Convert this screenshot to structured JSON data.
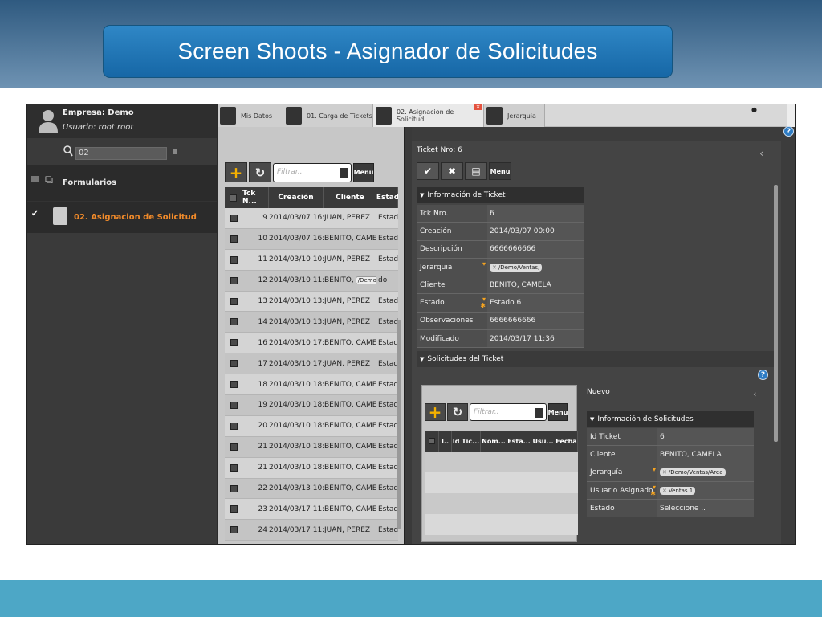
{
  "slide": {
    "title": "Screen Shoots - Asignador de Solicitudes",
    "colors": {
      "top": "#2f5a80",
      "title_bar": "#1f78b8",
      "bottom": "#4da7c6"
    }
  },
  "sidebar": {
    "company": "Empresa: Demo",
    "user": "Usuario: root root",
    "search_value": "02",
    "section_label": "Formularios",
    "active_item": "02. Asignacion de Solicitud",
    "active_color": "#f08a2a"
  },
  "tabs": [
    {
      "label": "Mis Datos"
    },
    {
      "label": "01. Carga de Tickets"
    },
    {
      "label": "02. Asignacion de Solicitud"
    },
    {
      "label": "Jerarquia"
    }
  ],
  "grid": {
    "filter_placeholder": "Filtrar..",
    "menu_label": "Menu",
    "columns": [
      "Tck N...",
      "Creación",
      "Cliente",
      "Estad"
    ],
    "rows": [
      {
        "n": "9",
        "fecha": "2014/03/07 16:30",
        "cliente": "JUAN, PEREZ",
        "estado": "Estado"
      },
      {
        "n": "10",
        "fecha": "2014/03/07 16:56",
        "cliente": "BENITO, CAMELA",
        "estado": "Estado"
      },
      {
        "n": "11",
        "fecha": "2014/03/10 10:29",
        "cliente": "JUAN, PEREZ",
        "estado": "Estado"
      },
      {
        "n": "12",
        "fecha": "2014/03/10 11:29",
        "cliente": "BENITO,",
        "tag": "/Demo/Ventas",
        "estado": "do"
      },
      {
        "n": "13",
        "fecha": "2014/03/10 13:03",
        "cliente": "JUAN, PEREZ",
        "estado": "Estado"
      },
      {
        "n": "14",
        "fecha": "2014/03/10 13:34",
        "cliente": "JUAN, PEREZ",
        "estado": "Estado"
      },
      {
        "n": "16",
        "fecha": "2014/03/10 17:21",
        "cliente": "BENITO, CAMELA",
        "estado": "Estado"
      },
      {
        "n": "17",
        "fecha": "2014/03/10 17:40",
        "cliente": "JUAN, PEREZ",
        "estado": "Estado"
      },
      {
        "n": "18",
        "fecha": "2014/03/10 18:00",
        "cliente": "BENITO, CAMELA",
        "estado": "Estado"
      },
      {
        "n": "19",
        "fecha": "2014/03/10 18:10",
        "cliente": "BENITO, CAMELA",
        "estado": "Estado"
      },
      {
        "n": "20",
        "fecha": "2014/03/10 18:23",
        "cliente": "BENITO, CAMELA",
        "estado": "Estado"
      },
      {
        "n": "21",
        "fecha": "2014/03/10 18:29",
        "cliente": "BENITO, CAMELA",
        "estado": "Estado"
      },
      {
        "n": "21",
        "fecha": "2014/03/10 18:29",
        "cliente": "BENITO, CAMELA",
        "estado": "Estado"
      },
      {
        "n": "22",
        "fecha": "2014/03/13 10:10",
        "cliente": "BENITO, CAMELA",
        "estado": "Estado"
      },
      {
        "n": "23",
        "fecha": "2014/03/17 11:43",
        "cliente": "BENITO, CAMELA",
        "estado": "Estado"
      },
      {
        "n": "24",
        "fecha": "2014/03/17 11:46",
        "cliente": "JUAN, PEREZ",
        "estado": "Estado"
      }
    ]
  },
  "detail": {
    "header": "Ticket Nro: 6",
    "menu_label": "Menu",
    "info_title": "Información de Ticket",
    "fields": [
      {
        "label": "Tck Nro.",
        "value": "6"
      },
      {
        "label": "Creación",
        "value": "2014/03/07 00:00"
      },
      {
        "label": "Descripción",
        "value": "6666666666"
      },
      {
        "label": "Jerarquia",
        "chip": "/Demo/Ventas,",
        "mark": "▾"
      },
      {
        "label": "Cliente",
        "value": "BENITO, CAMELA"
      },
      {
        "label": "Estado",
        "value": "Estado 6",
        "mark": "▾",
        "star": "✱"
      },
      {
        "label": "Observaciones",
        "value": "6666666666"
      },
      {
        "label": "Modificado",
        "value": "2014/03/17 11:36"
      }
    ],
    "solicitudes_title": "Solicitudes del Ticket",
    "sub_filter_placeholder": "Filtrar..",
    "sub_menu_label": "Menu",
    "sub_columns": [
      "I..",
      "Id Tic...",
      "Nom...",
      "Esta...",
      "Usu...",
      "Fecha"
    ],
    "nuevo_label": "Nuevo",
    "sol_info_title": "Información de Solicitudes",
    "sol_fields": [
      {
        "label": "Id Ticket",
        "value": "6"
      },
      {
        "label": "Cliente",
        "value": "BENITO, CAMELA"
      },
      {
        "label": "Jerarquía",
        "chip": "/Demo/Ventas/Area",
        "mark": "▾"
      },
      {
        "label": "Usuario Asignado",
        "chip": "Ventas 1",
        "mark": "▾",
        "star": "✱"
      },
      {
        "label": "Estado",
        "value": "Seleccione .."
      }
    ]
  },
  "icons": {
    "check": "check-icon",
    "cancel": "x-icon",
    "form": "form-icon",
    "add": "plus-icon",
    "refresh": "refresh-icon",
    "help": "help-icon",
    "search": "search-icon"
  }
}
